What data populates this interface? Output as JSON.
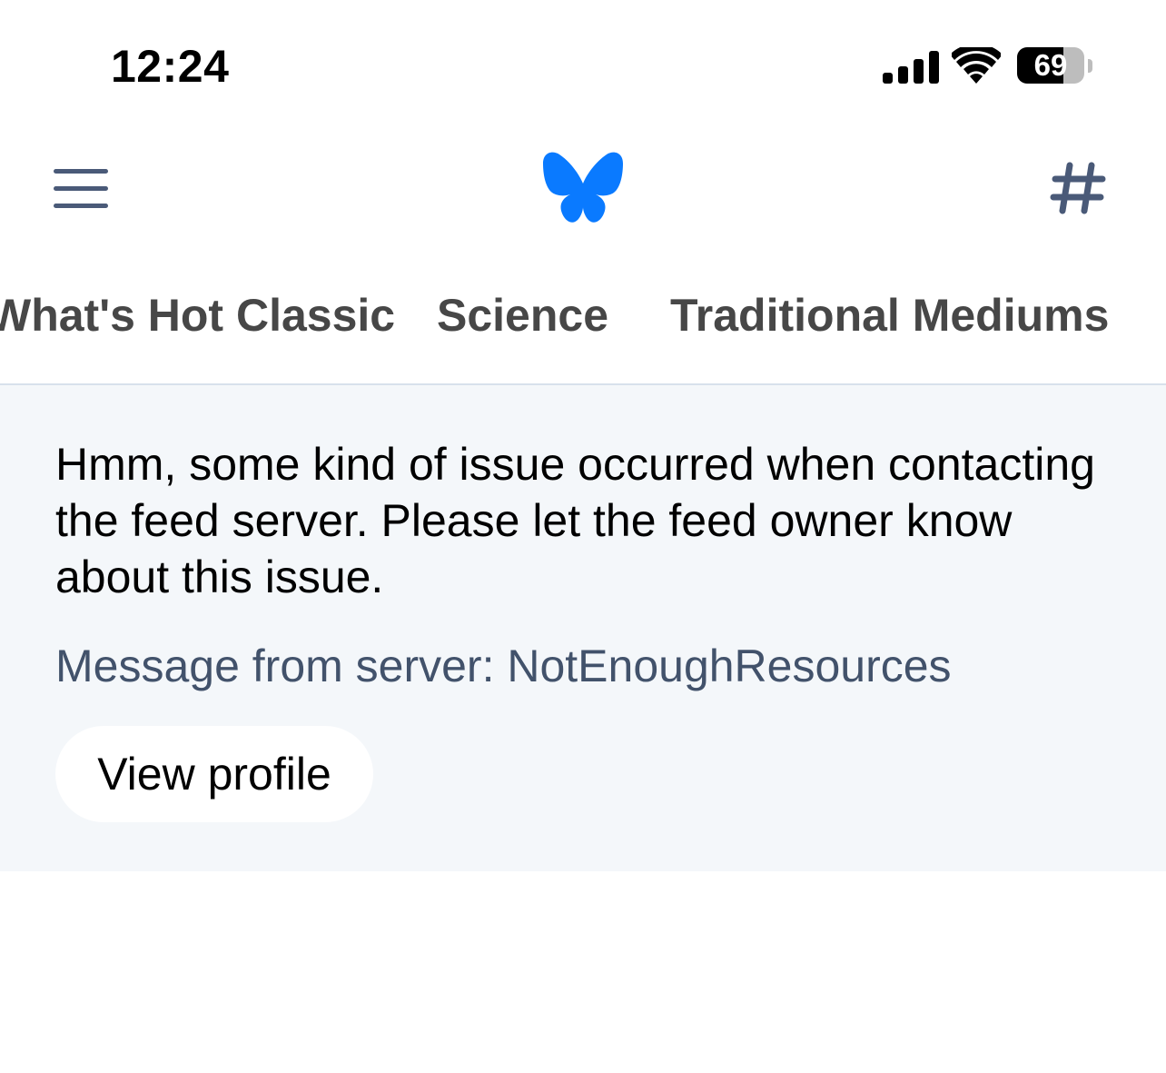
{
  "status_bar": {
    "time": "12:24",
    "battery_level": "69",
    "battery_fraction": 0.69,
    "icons": [
      "signal-icon",
      "wifi-icon",
      "battery-icon"
    ]
  },
  "header": {
    "menu_icon": "hamburger-menu-icon",
    "logo_icon": "butterfly-logo-icon",
    "feeds_icon": "hash-icon",
    "logo_color": "#0a7aff",
    "icon_color": "#4a5a78"
  },
  "tabs": [
    {
      "label": "What's Hot Classic"
    },
    {
      "label": "Science"
    },
    {
      "label": "Traditional Mediums"
    }
  ],
  "error": {
    "message": "Hmm, some kind of issue occurred when contacting the feed server. Please let the feed owner know about this issue.",
    "server_message": "Message from server: NotEnoughResources",
    "button_label": "View profile"
  }
}
